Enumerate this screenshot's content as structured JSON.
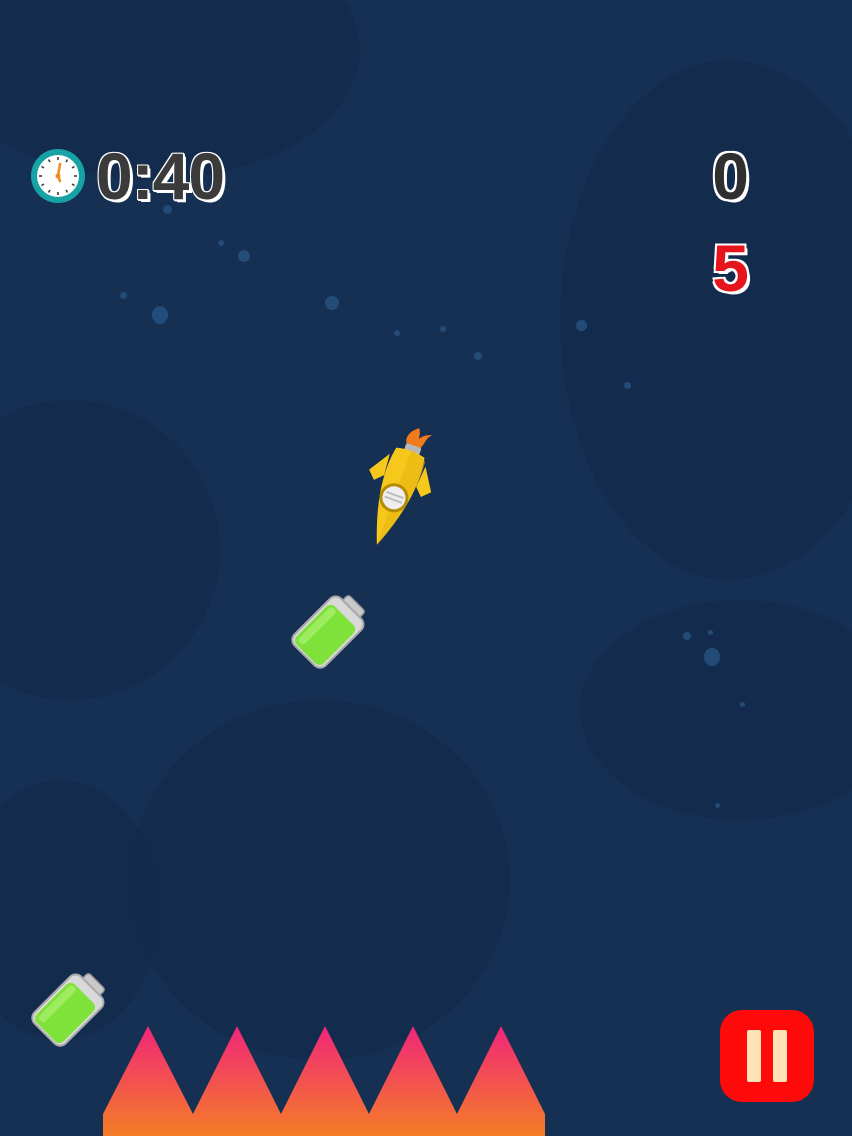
{
  "hud": {
    "timer": "0:40",
    "score": "0",
    "lives": "5",
    "clock_icon": "stopwatch-icon",
    "pause_icon": "pause-icon"
  },
  "colors": {
    "background": "#153052",
    "timer_text": "#3b3b3b",
    "lives_text": "#e6151d",
    "pause_button": "#ff0a0a",
    "rocket": "#f7c81c",
    "battery": "#7ee23b",
    "spike_top": "#f0267a",
    "spike_bottom": "#f57d26"
  },
  "game_objects": {
    "player": "rocket",
    "pickups": [
      "battery",
      "battery"
    ],
    "hazard": "spikes"
  }
}
